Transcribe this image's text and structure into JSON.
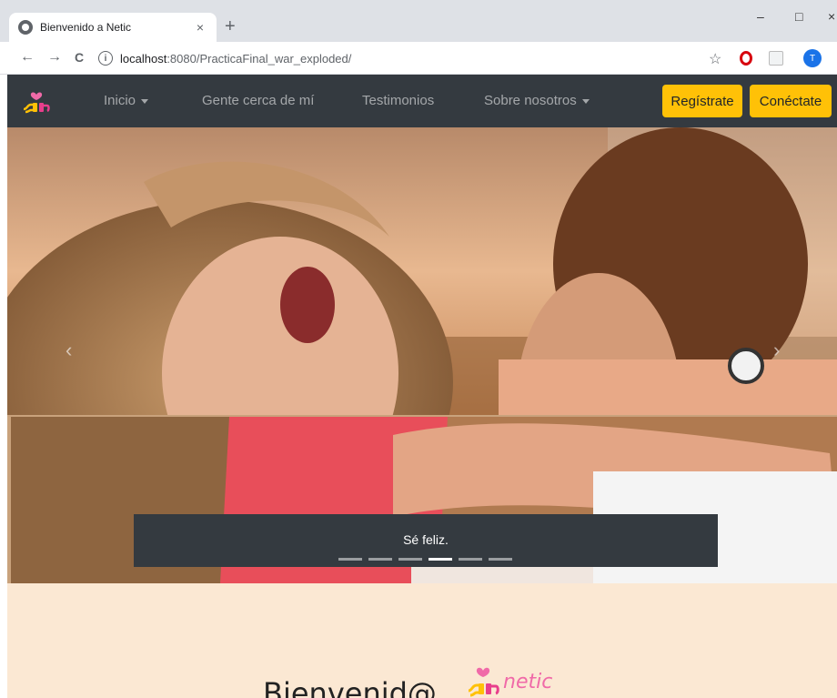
{
  "browser": {
    "tab_title": "Bienvenido a Netic",
    "tab_close": "×",
    "new_tab": "+",
    "window_controls": {
      "minimize": "–",
      "maximize": "□",
      "close": "×"
    },
    "nav": {
      "back": "←",
      "forward": "→",
      "reload": "C"
    },
    "url_host": "localhost",
    "url_rest": ":8080/PracticaFinal_war_exploded/",
    "star": "☆",
    "profile_initial": "T"
  },
  "site_nav": {
    "items": [
      {
        "label": "Inicio",
        "dropdown": true
      },
      {
        "label": "Gente cerca de mí",
        "dropdown": false
      },
      {
        "label": "Testimonios",
        "dropdown": false
      },
      {
        "label": "Sobre nosotros",
        "dropdown": true
      }
    ],
    "register_label": "Regístrate",
    "login_label": "Conéctate"
  },
  "carousel": {
    "prev_icon": "‹",
    "next_icon": "›",
    "caption": "Sé feliz.",
    "indicators": 6,
    "active_index": 3
  },
  "welcome": {
    "title": "Bienvenid@",
    "brand": "netic"
  },
  "colors": {
    "navbar_bg": "#343a40",
    "button_yellow": "#ffc107",
    "welcome_bg": "#fbe8d3",
    "brand_pink": "#f06aa8"
  }
}
